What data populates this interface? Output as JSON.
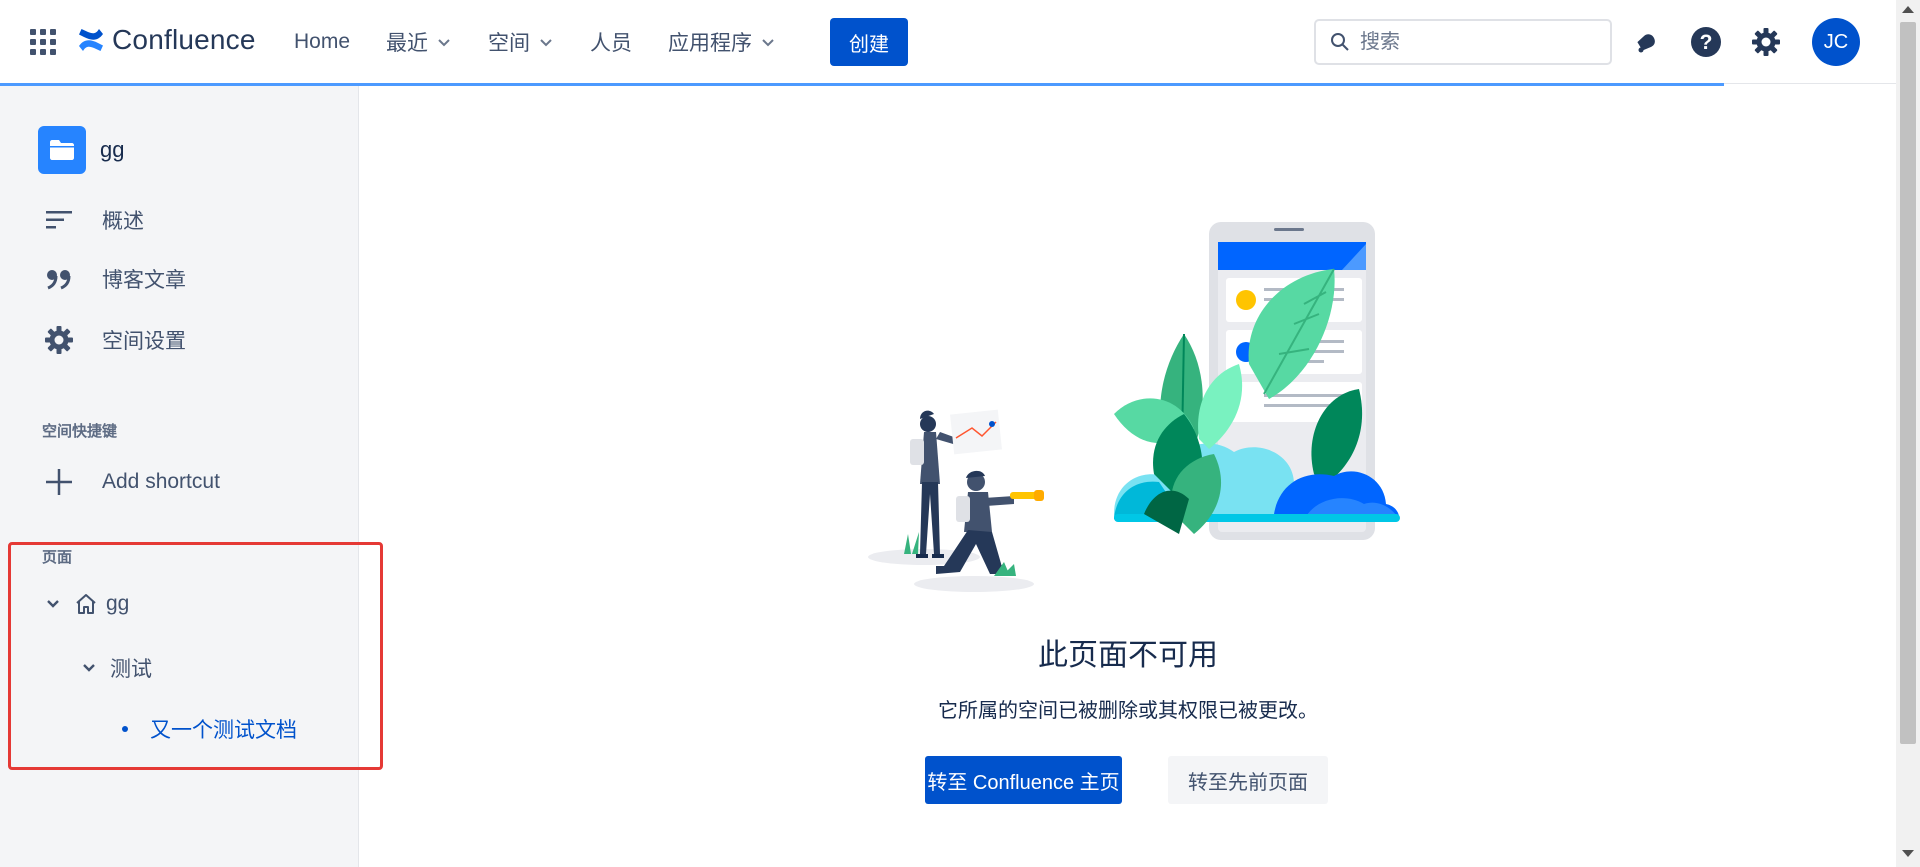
{
  "nav": {
    "logo_text": "Confluence",
    "links": [
      {
        "label": "Home",
        "has_dropdown": false
      },
      {
        "label": "最近",
        "has_dropdown": true
      },
      {
        "label": "空间",
        "has_dropdown": true
      },
      {
        "label": "人员",
        "has_dropdown": false
      },
      {
        "label": "应用程序",
        "has_dropdown": true
      }
    ],
    "create_label": "创建",
    "search_placeholder": "搜索",
    "avatar_initials": "JC",
    "icons": [
      "app-switcher-icon",
      "notification-bell-icon",
      "help-icon",
      "settings-gear-icon"
    ],
    "accent_color": "#0052cc"
  },
  "sidebar": {
    "space_name": "gg",
    "items": [
      {
        "label": "概述",
        "icon": "overview-lines-icon"
      },
      {
        "label": "博客文章",
        "icon": "blog-quote-icon"
      },
      {
        "label": "空间设置",
        "icon": "space-settings-gear-icon"
      }
    ],
    "shortcuts_title": "空间快捷键",
    "add_shortcut_label": "Add shortcut",
    "pages_title": "页面",
    "tree": [
      {
        "label": "gg",
        "icon": "home-icon",
        "expanded": true,
        "level": 0
      },
      {
        "label": "测试",
        "expanded": true,
        "level": 1
      },
      {
        "label": "又一个测试文档",
        "current": true,
        "level": 2
      }
    ]
  },
  "main": {
    "title": "此页面不可用",
    "subtitle": "它所属的空间已被删除或其权限已被更改。",
    "primary_button": "转至 Confluence 主页",
    "secondary_button": "转至先前页面"
  }
}
